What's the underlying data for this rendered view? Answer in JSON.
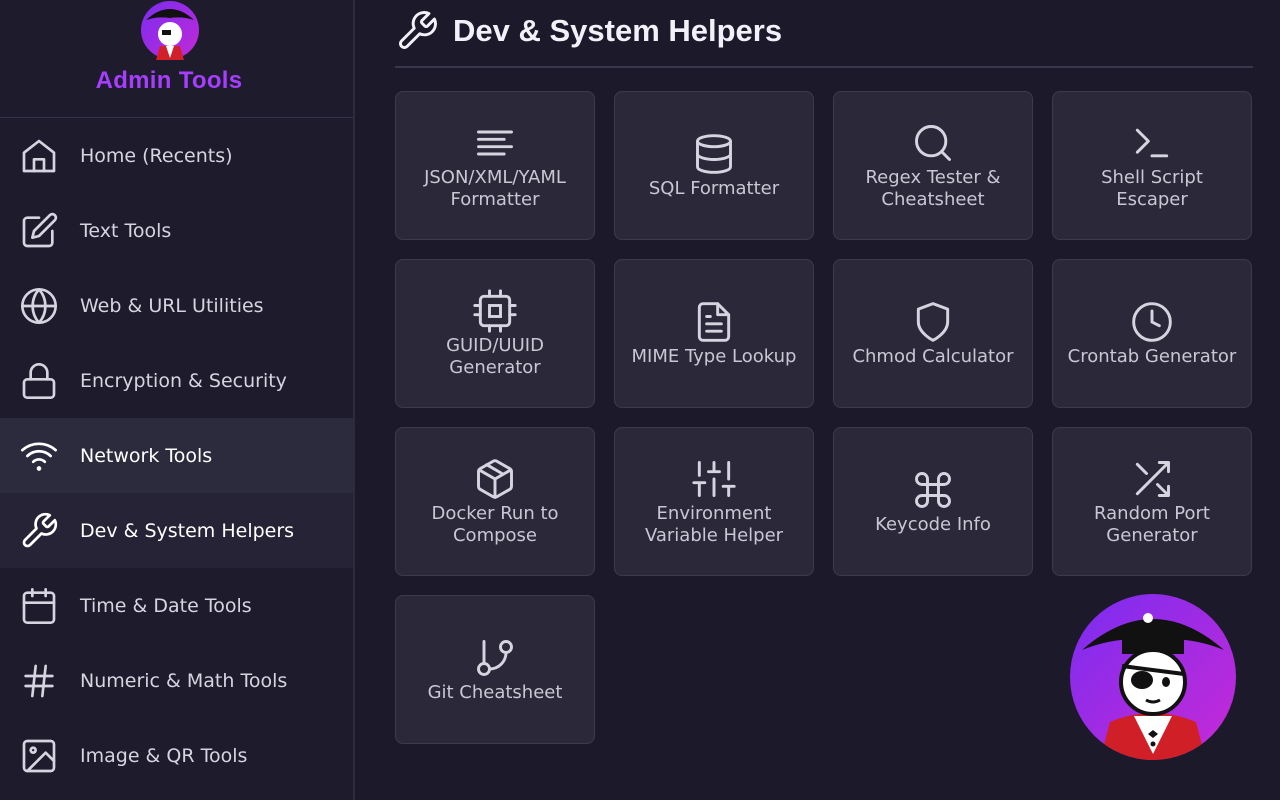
{
  "brand": {
    "title": "Admin Tools",
    "logo_icon": "pirate-logo"
  },
  "sidebar": {
    "items": [
      {
        "label": "Home (Recents)",
        "icon": "home-icon"
      },
      {
        "label": "Text Tools",
        "icon": "edit-icon"
      },
      {
        "label": "Web & URL Utilities",
        "icon": "globe-icon"
      },
      {
        "label": "Encryption & Security",
        "icon": "lock-icon"
      },
      {
        "label": "Network Tools",
        "icon": "wifi-icon"
      },
      {
        "label": "Dev & System Helpers",
        "icon": "wrench-icon"
      },
      {
        "label": "Time & Date Tools",
        "icon": "calendar-icon"
      },
      {
        "label": "Numeric & Math Tools",
        "icon": "hash-icon"
      },
      {
        "label": "Image & QR Tools",
        "icon": "image-icon"
      }
    ]
  },
  "page": {
    "title": "Dev & System Helpers",
    "icon": "wrench-icon"
  },
  "cards": [
    {
      "label": "JSON/XML/YAML Formatter",
      "icon": "align-left-icon"
    },
    {
      "label": "SQL Formatter",
      "icon": "database-icon"
    },
    {
      "label": "Regex Tester & Cheatsheet",
      "icon": "search-icon"
    },
    {
      "label": "Shell Script Escaper",
      "icon": "terminal-icon"
    },
    {
      "label": "GUID/UUID Generator",
      "icon": "cpu-icon"
    },
    {
      "label": "MIME Type Lookup",
      "icon": "file-text-icon"
    },
    {
      "label": "Chmod Calculator",
      "icon": "shield-icon"
    },
    {
      "label": "Crontab Generator",
      "icon": "clock-icon"
    },
    {
      "label": "Docker Run to Compose",
      "icon": "box-icon"
    },
    {
      "label": "Environment Variable Helper",
      "icon": "sliders-icon"
    },
    {
      "label": "Keycode Info",
      "icon": "command-icon"
    },
    {
      "label": "Random Port Generator",
      "icon": "shuffle-icon"
    },
    {
      "label": "Git Cheatsheet",
      "icon": "git-branch-icon"
    }
  ],
  "colors": {
    "accent": "#a63dff",
    "background": "#1c1a2a",
    "card": "#2b2939"
  }
}
